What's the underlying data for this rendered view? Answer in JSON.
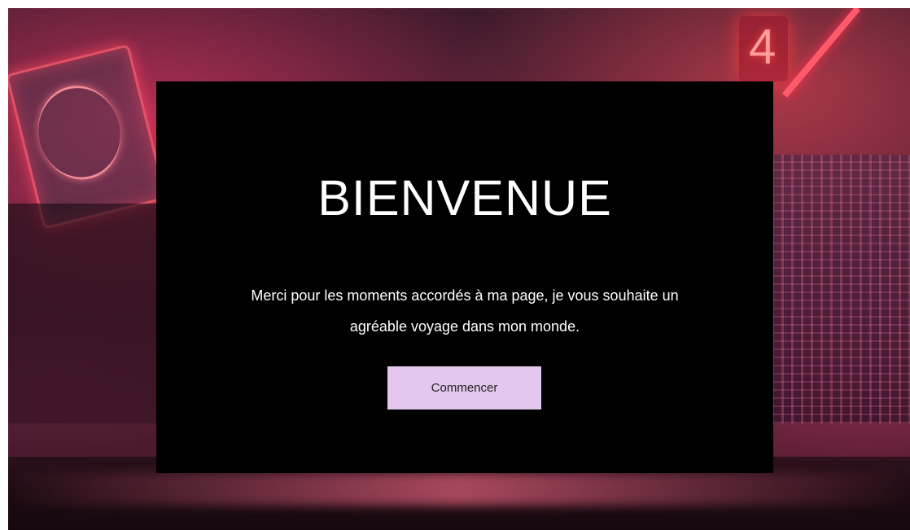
{
  "background": {
    "neon_sign_text": "4"
  },
  "welcome": {
    "title": "BIENVENUE",
    "message": "Merci pour les moments accordés à ma page, je vous souhaite un agréable voyage dans mon monde.",
    "button_label": "Commencer",
    "card_color": "#000000",
    "button_color": "#e4c6ee"
  }
}
